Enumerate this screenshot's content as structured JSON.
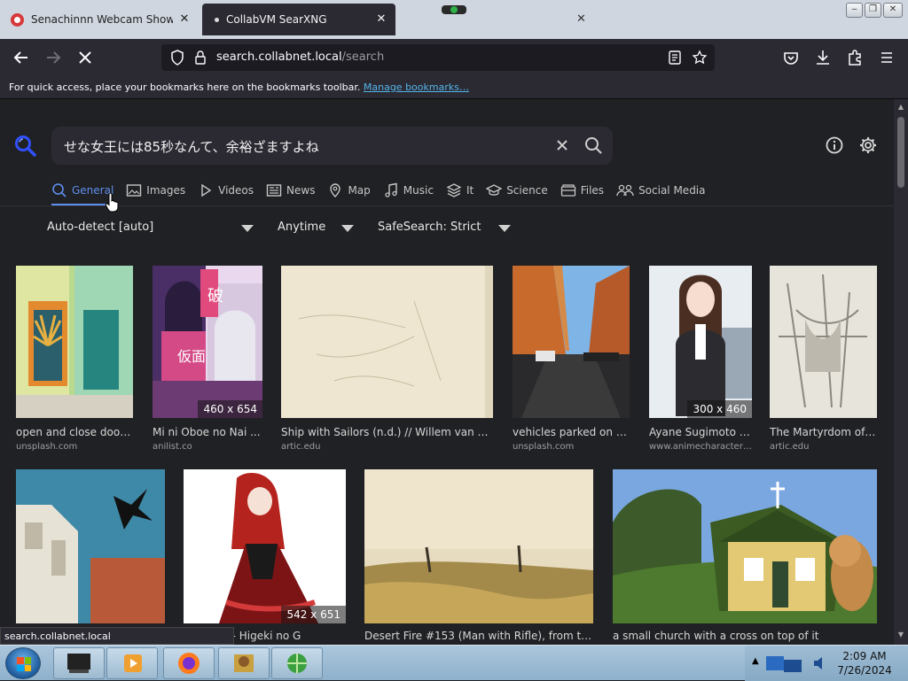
{
  "browser": {
    "tabs": [
      {
        "title": "Senachinnn Webcam Show | JA"
      },
      {
        "title": "CollabVM SearXNG"
      }
    ],
    "url_host": "search.collabnet.local",
    "url_path": "/search",
    "bookmarks_text": "For quick access, place your bookmarks here on the bookmarks toolbar.",
    "bookmarks_link": "Manage bookmarks…",
    "status_url": "search.collabnet.local"
  },
  "search": {
    "query": "せな女王には85秒なんて、余裕ざますよね"
  },
  "categories": [
    {
      "label": "General",
      "icon": "search-icon",
      "active": true
    },
    {
      "label": "Images",
      "icon": "image-icon"
    },
    {
      "label": "Videos",
      "icon": "play-icon"
    },
    {
      "label": "News",
      "icon": "newspaper-icon"
    },
    {
      "label": "Map",
      "icon": "map-pin-icon"
    },
    {
      "label": "Music",
      "icon": "music-icon"
    },
    {
      "label": "It",
      "icon": "layers-icon"
    },
    {
      "label": "Science",
      "icon": "science-icon"
    },
    {
      "label": "Files",
      "icon": "files-icon"
    },
    {
      "label": "Social Media",
      "icon": "people-icon"
    }
  ],
  "filters": {
    "language": "Auto-detect [auto]",
    "time": "Anytime",
    "safesearch": "SafeSearch: Strict"
  },
  "results": [
    {
      "title": "open and close door...",
      "source": "unsplash.com",
      "size": ""
    },
    {
      "title": "Mi ni Oboe no Nai ...",
      "source": "anilist.co",
      "size": "460 x 654"
    },
    {
      "title": "Ship with Sailors (n.d.) // Willem van d...",
      "source": "artic.edu",
      "size": ""
    },
    {
      "title": "vehicles parked on s...",
      "source": "unsplash.com",
      "size": ""
    },
    {
      "title": "Ayane Sugimoto f...",
      "source": "www.animecharactersd...",
      "size": "300 x 460"
    },
    {
      "title": "The Martyrdom of ...",
      "source": "artic.edu",
      "size": ""
    },
    {
      "title": "",
      "source": "",
      "size": ""
    },
    {
      "title": "yal Ivy - Higeki no G...",
      "source": "",
      "size": "542 x 651"
    },
    {
      "title": "Desert Fire #153 (Man with Rifle), from the...",
      "source": "",
      "size": ""
    },
    {
      "title": "a small church with a cross on top of it",
      "source": "",
      "size": ""
    }
  ],
  "taskbar": {
    "time": "2:09 AM",
    "date": "7/26/2024"
  },
  "colors": {
    "page_bg": "#202124",
    "accent": "#5f8ff0",
    "chrome_bg": "#2b2a33"
  }
}
